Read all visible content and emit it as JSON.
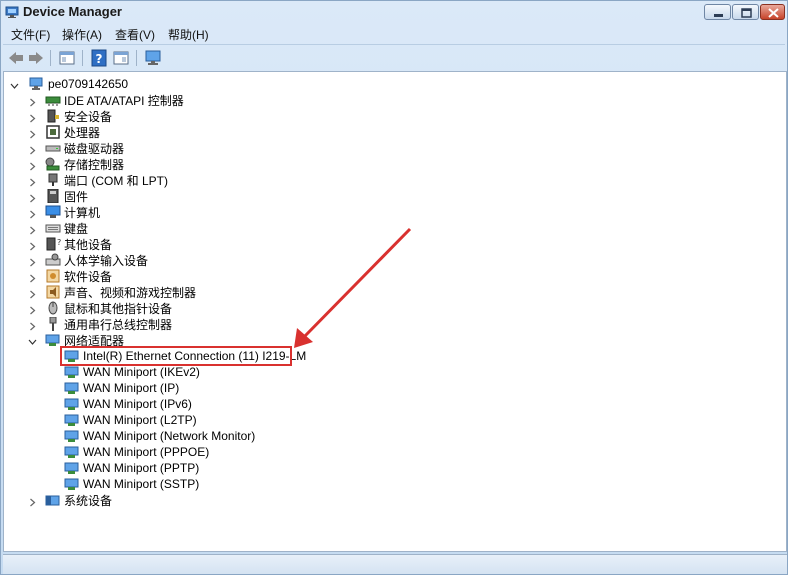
{
  "window": {
    "title": "Device Manager"
  },
  "menu": {
    "file": "文件(F)",
    "action": "操作(A)",
    "view": "查看(V)",
    "help": "帮助(H)"
  },
  "tree": {
    "root": "pe0709142650",
    "categories": [
      "IDE ATA/ATAPI 控制器",
      "安全设备",
      "处理器",
      "磁盘驱动器",
      "存储控制器",
      "端口 (COM 和 LPT)",
      "固件",
      "计算机",
      "键盘",
      "其他设备",
      "人体学输入设备",
      "软件设备",
      "声音、视频和游戏控制器",
      "鼠标和其他指针设备",
      "通用串行总线控制器"
    ],
    "network_category": "网络适配器",
    "network_devices": [
      "Intel(R) Ethernet Connection (11) I219-LM",
      "WAN Miniport (IKEv2)",
      "WAN Miniport (IP)",
      "WAN Miniport (IPv6)",
      "WAN Miniport (L2TP)",
      "WAN Miniport (Network Monitor)",
      "WAN Miniport (PPPOE)",
      "WAN Miniport (PPTP)",
      "WAN Miniport (SSTP)"
    ],
    "last_category": "系统设备"
  },
  "colors": {
    "annotation": "#d9312f",
    "window_frame": "#cfe3f5"
  }
}
